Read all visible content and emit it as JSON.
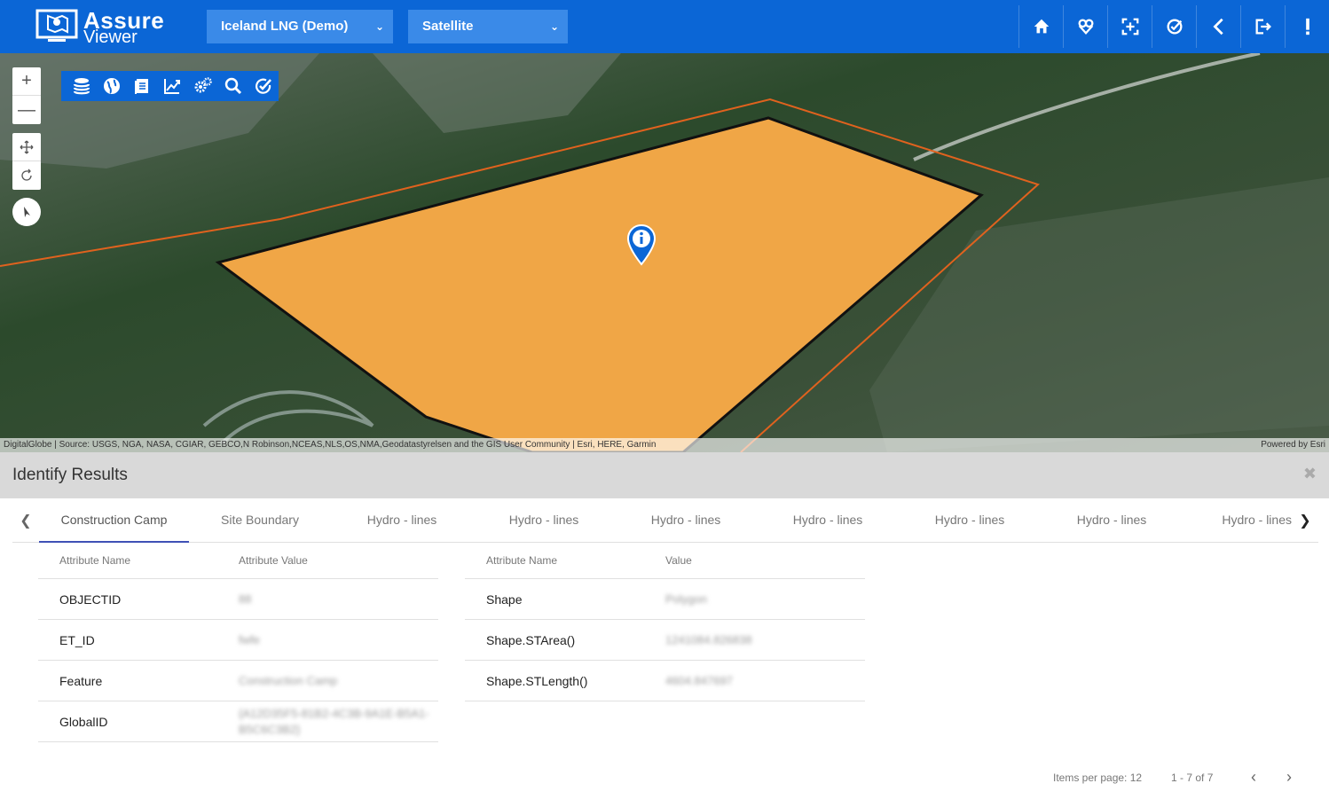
{
  "header": {
    "logo_line1": "Assure",
    "logo_line2": "Viewer",
    "project_select": "Iceland LNG (Demo)",
    "basemap_select": "Satellite",
    "buttons": [
      "home-icon",
      "location-icon",
      "zoom-extent-icon",
      "checklist-icon",
      "back-icon",
      "logout-icon",
      "alert-icon"
    ]
  },
  "map": {
    "zoom_in": "+",
    "zoom_out": "—",
    "toolbar_icons": [
      "layers-icon",
      "globe-icon",
      "document-icon",
      "chart-icon",
      "settings-icon",
      "search-icon",
      "check-circle-icon"
    ],
    "attribution": "DigitalGlobe | Source: USGS, NGA, NASA, CGIAR, GEBCO,N Robinson,NCEAS,NLS,OS,NMA,Geodatastyrelsen and the GIS User Community | Esri, HERE, Garmin",
    "powered_by": "Powered by Esri",
    "colors": {
      "polygon_fill": "#f0a646",
      "boundary": "#e0621e",
      "header": "#0b66d6"
    }
  },
  "identify": {
    "title": "Identify Results",
    "close": "✖",
    "tabs": [
      "Construction Camp",
      "Site Boundary",
      "Hydro - lines",
      "Hydro - lines",
      "Hydro - lines",
      "Hydro - lines",
      "Hydro - lines",
      "Hydro - lines",
      "Hydro - lines"
    ],
    "table1": {
      "col1": "Attribute Name",
      "col2": "Attribute Value",
      "rows": [
        {
          "name": "OBJECTID",
          "value": "88"
        },
        {
          "name": "ET_ID",
          "value": "fwfe"
        },
        {
          "name": "Feature",
          "value": "Construction Camp"
        },
        {
          "name": "GlobalID",
          "value": "{A12D35F5-81B2-4C3B-9A1E-B5A1-B5C6C3B2}"
        }
      ]
    },
    "table2": {
      "col1": "Attribute Name",
      "col2": "Value",
      "rows": [
        {
          "name": "Shape",
          "value": "Polygon"
        },
        {
          "name": "Shape.STArea()",
          "value": "1241084.826838"
        },
        {
          "name": "Shape.STLength()",
          "value": "4604.847697"
        }
      ]
    },
    "pager": {
      "items_per_page": "Items per page: 12",
      "range": "1 - 7 of 7"
    }
  }
}
